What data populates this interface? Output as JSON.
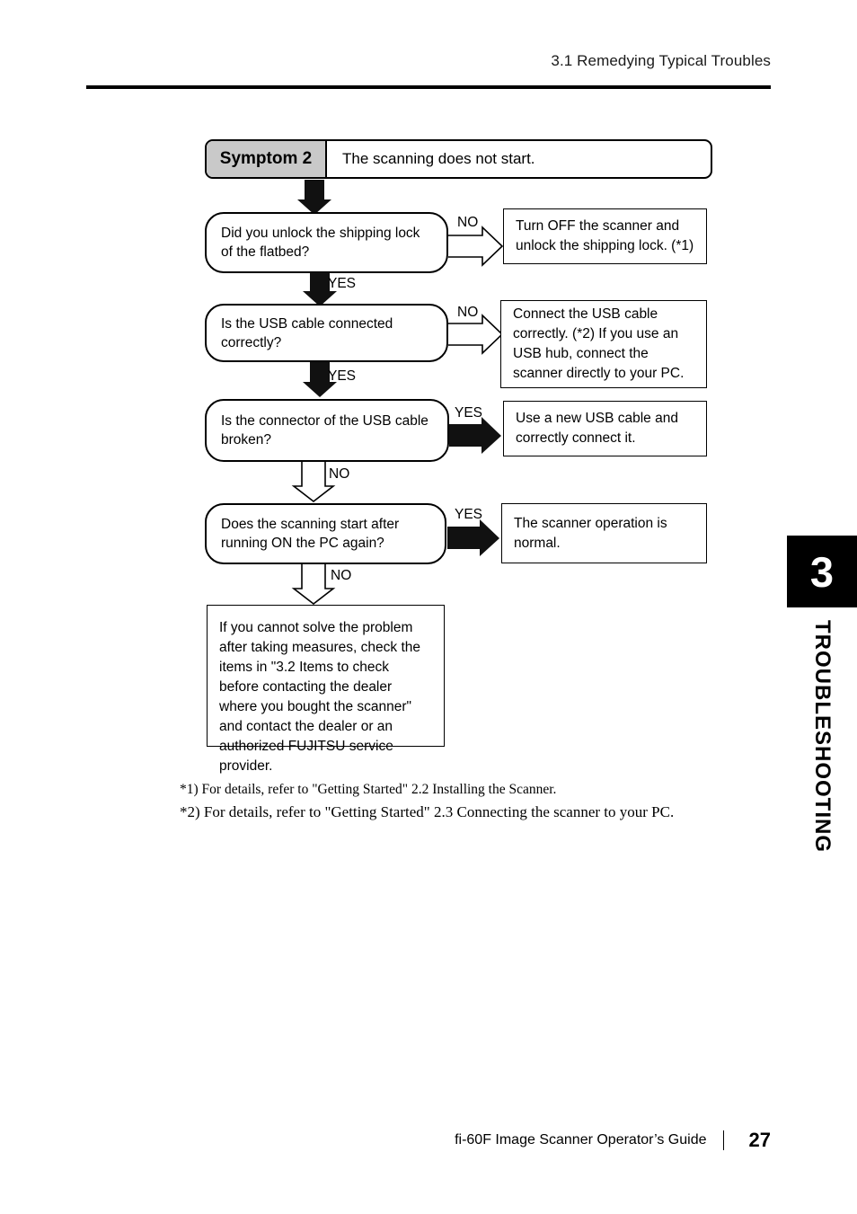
{
  "header": {
    "title": "3.1 Remedying Typical Troubles"
  },
  "symptom": {
    "label": "Symptom 2",
    "text": "The scanning does not start."
  },
  "flow": {
    "steps": [
      {
        "question": "Did you unlock the shipping lock of the flatbed?",
        "branch_side_label": "NO",
        "branch_down_label": "YES",
        "side_arrow_style": "hollow",
        "down_arrow_style": "solid",
        "result": "Turn OFF the scanner and unlock the shipping lock. (*1)"
      },
      {
        "question": "Is the USB cable connected correctly?",
        "branch_side_label": "NO",
        "branch_down_label": "YES",
        "side_arrow_style": "hollow",
        "down_arrow_style": "solid",
        "result": "Connect the USB cable correctly. (*2) If you use an USB hub, connect the scanner directly to your PC."
      },
      {
        "question": "Is the connector of the USB cable broken?",
        "branch_side_label": "YES",
        "branch_down_label": "NO",
        "side_arrow_style": "solid",
        "down_arrow_style": "hollow",
        "result": "Use a new USB cable and correctly connect it."
      },
      {
        "question": "Does the scanning start after running ON the PC again?",
        "branch_side_label": "YES",
        "branch_down_label": "NO",
        "side_arrow_style": "solid",
        "down_arrow_style": "hollow",
        "result": "The scanner operation is normal."
      }
    ],
    "final_note": "If you cannot solve the problem after taking measures, check the items in \"3.2 Items to check before contacting the dealer where you bought the scanner\" and contact the dealer or an authorized FUJITSU service provider."
  },
  "footnotes": {
    "note1": "*1) For details, refer to \"Getting Started\" 2.2 Installing the Scanner.",
    "note2": "*2) For details, refer to \"Getting Started\" 2.3 Connecting the scanner to your PC."
  },
  "side_tab": {
    "number": "3",
    "label": "TROUBLESHOOTING"
  },
  "footer": {
    "guide_title": "fi-60F Image Scanner Operator’s Guide",
    "page_number": "27"
  },
  "colors": {
    "ink": "#000000",
    "symptom_label_bg": "#c9c9c9",
    "page_bg": "#ffffff"
  }
}
